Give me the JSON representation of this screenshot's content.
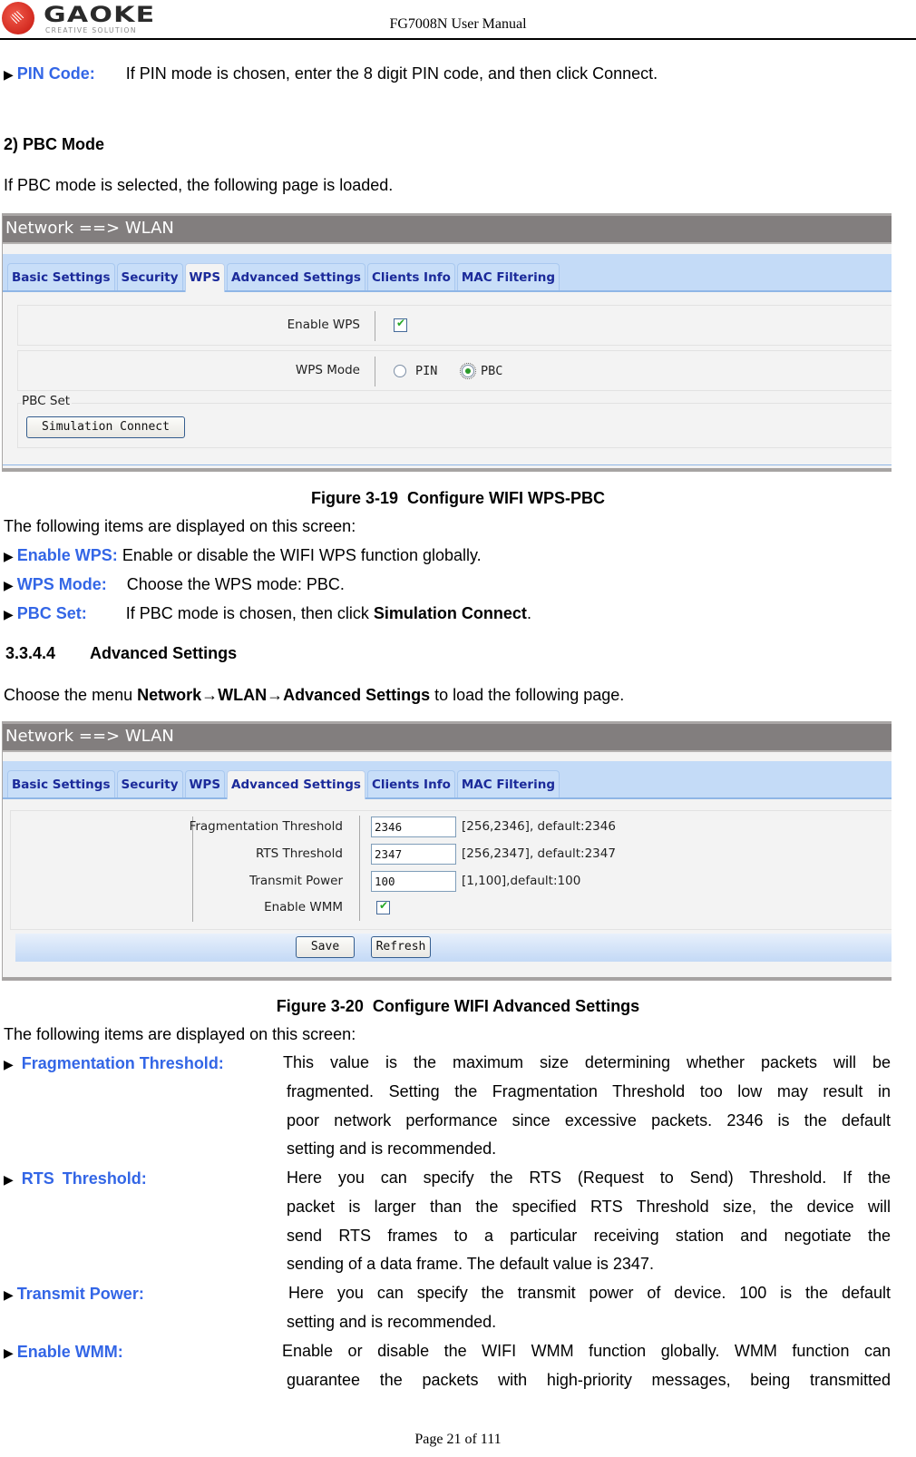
{
  "header": {
    "logo_word": "GAOKE",
    "logo_tagline": "CREATIVE SOLUTION",
    "doc_title": "FG7008N User Manual"
  },
  "pin_code_item": {
    "term": "PIN Code:",
    "text": "If PIN mode is chosen, enter the 8 digit PIN code, and then click Connect."
  },
  "pbc_section": {
    "heading": "2) PBC Mode",
    "intro": "If PBC mode is selected, the following page is loaded."
  },
  "figure_wps": {
    "title_bar": "Network ==> WLAN",
    "tabs": [
      "Basic Settings",
      "Security",
      "WPS",
      "Advanced Settings",
      "Clients Info",
      "MAC Filtering"
    ],
    "active_tab": "WPS",
    "enable_wps_label": "Enable WPS",
    "enable_wps_checked": true,
    "wps_mode_label": "WPS Mode",
    "wps_mode_options": [
      "PIN",
      "PBC"
    ],
    "wps_mode_selected": "PBC",
    "pbc_set_label": "PBC Set",
    "simulation_connect_button": "Simulation Connect",
    "caption_num": "Figure 3-19",
    "caption_text": "Configure WIFI WPS-PBC"
  },
  "wps_items": {
    "intro": "The following items are displayed on this screen:",
    "items": [
      {
        "term": "Enable WPS:",
        "text": "Enable or disable the WIFI WPS function globally."
      },
      {
        "term": "WPS Mode:",
        "text": "Choose the WPS mode: PBC."
      },
      {
        "term": "PBC Set:",
        "text_before": "If PBC mode is chosen, then click ",
        "text_bold": "Simulation Connect",
        "text_after": "."
      }
    ]
  },
  "advanced_section": {
    "number": "3.3.4.4",
    "title": "Advanced Settings",
    "intro_before": "Choose the menu ",
    "intro_path": "Network→WLAN→Advanced Settings",
    "intro_after": " to load the following page."
  },
  "figure_advanced": {
    "title_bar": "Network ==> WLAN",
    "tabs": [
      "Basic Settings",
      "Security",
      "WPS",
      "Advanced Settings",
      "Clients Info",
      "MAC Filtering"
    ],
    "active_tab": "Advanced Settings",
    "fields": [
      {
        "label": "Fragmentation Threshold",
        "value": "2346",
        "hint": "[256,2346], default:2346"
      },
      {
        "label": "RTS Threshold",
        "value": "2347",
        "hint": "[256,2347], default:2347"
      },
      {
        "label": "Transmit Power",
        "value": "100",
        "hint": "[1,100],default:100"
      }
    ],
    "enable_wmm_label": "Enable WMM",
    "enable_wmm_checked": true,
    "save_button": "Save",
    "refresh_button": "Refresh",
    "caption_num": "Figure 3-20",
    "caption_text": "Configure WIFI Advanced Settings"
  },
  "advanced_items": {
    "intro": "The following items are displayed on this screen:",
    "items": [
      {
        "term": "Fragmentation Threshold:",
        "lines": [
          "This value is the maximum size determining whether packets will be",
          "fragmented. Setting the Fragmentation Threshold too low may result in",
          "poor network performance since excessive packets. 2346 is the default",
          "setting and is recommended."
        ]
      },
      {
        "term": "RTS Threshold:",
        "lines": [
          "Here you can specify the RTS (Request to Send) Threshold. If the",
          "packet is larger than the specified RTS Threshold size, the device will",
          "send RTS frames to a particular receiving station and negotiate the",
          "sending of a data frame. The default value is 2347."
        ]
      },
      {
        "term": "Transmit Power:",
        "lines": [
          "Here you can specify the transmit power of device. 100 is the default",
          "setting and is recommended."
        ]
      },
      {
        "term": "Enable WMM:",
        "lines": [
          "Enable or disable the WIFI WMM function globally. WMM function can",
          "guarantee the packets with high-priority messages, being transmitted"
        ]
      }
    ]
  },
  "footer": {
    "page_label": "Page 21 of 111"
  },
  "colors": {
    "term_blue": "#3366e6",
    "tab_text": "#1b2a9a",
    "title_bar": "#827e7e",
    "tab_bar": "#c4dbf7"
  }
}
